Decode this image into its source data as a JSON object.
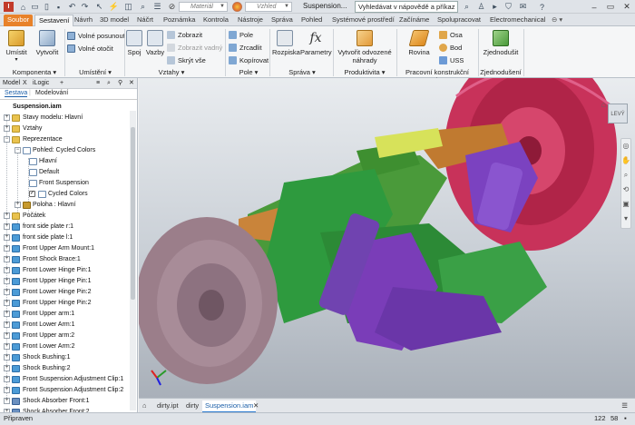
{
  "titlebar": {
    "material_placeholder": "Materiál",
    "appearance_placeholder": "Vzhled",
    "document_title": "Suspension...",
    "help_search": "Vyhledávat v nápovědě a příkaz"
  },
  "tabs": [
    "Soubor",
    "Sestavení",
    "Návrh",
    "3D model",
    "Náčrt",
    "Poznámka",
    "Kontrola",
    "Nástroje",
    "Správa",
    "Pohled",
    "Systémové prostředí",
    "Začínáme",
    "Spolupracovat",
    "Electromechanical"
  ],
  "active_tab": "Sestavení",
  "ribbon": {
    "umistit": "Umístit",
    "vytvorit": "Vytvořit",
    "komponenta": "Komponenta",
    "volne_posunout": "Volné posunout",
    "volne_otocit": "Volné otočit",
    "umisteni": "Umístění",
    "spoj": "Spoj",
    "vazby": "Vazby",
    "zobrazit": "Zobrazit",
    "zobrazit_vadny": "Zobrazit vadný",
    "skryt_vse": "Skrýt vše",
    "vztahy": "Vztahy",
    "pole_btn": "Pole",
    "zrcadlit": "Zrcadlit",
    "kopirovat": "Kopírovat",
    "pole_panel": "Pole",
    "rozpiska": "Rozpiska",
    "parametry": "Parametry",
    "sprava": "Správa",
    "vytvorit_nahrady": "Vytvořit odvozené náhrady",
    "produktivita": "Produktivita",
    "rovina": "Rovina",
    "osa": "Osa",
    "bod": "Bod",
    "uss": "USS",
    "pracovni_prvky": "Pracovní konstrukční prvky",
    "zjednodusit": "Zjednodušit",
    "zjednoduseni": "Zjednodušení"
  },
  "browser": {
    "title": "Model",
    "title_x": "X",
    "tab_logic": "iLogic",
    "tab_sestava": "Sestava",
    "tab_modelovani": "Modelování",
    "items": [
      "Suspension.iam",
      "Stavy modelu: Hlavní",
      "Vztahy",
      "Reprezentace",
      "Pohled: Cycled Colors",
      "Hlavní",
      "Default",
      "Front Suspension",
      "Cycled Colors",
      "Poloha : Hlavní",
      "Počátek",
      "front side plate r:1",
      "front side plate l:1",
      "Front Upper Arm Mount:1",
      "Front Shock Brace:1",
      "Front Lower Hinge Pin:1",
      "Front Upper Hinge Pin:1",
      "Front Lower Hinge Pin:2",
      "Front Upper Hinge Pin:2",
      "Front Upper arm:1",
      "Front Lower Arm:1",
      "Front Upper arm:2",
      "Front Lower Arm:2",
      "Shock Bushing:1",
      "Shock Bushing:2",
      "Front Suspension Adjustment Clip:1",
      "Front Suspension Adjustment Clip:2",
      "Shock Absorber Front:1",
      "Shock Absorber Front:2"
    ]
  },
  "doc_tabs": [
    "dirty.ipt",
    "dirty",
    "Suspension.iam"
  ],
  "status": {
    "left": "Připraven",
    "num1": "122",
    "num2": "58"
  },
  "viewcube_label": "LEVÝ"
}
